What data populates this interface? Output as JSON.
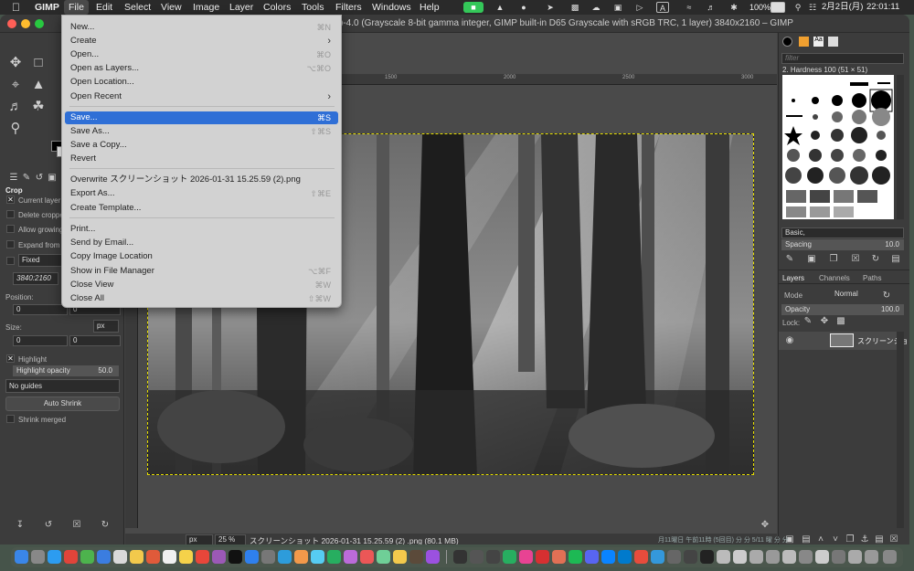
{
  "menubar": {
    "app": "GIMP",
    "items": [
      "File",
      "Edit",
      "Select",
      "View",
      "Image",
      "Layer",
      "Colors",
      "Tools",
      "Filters",
      "Windows",
      "Help"
    ],
    "date": "2月2日(月)",
    "time": "22:01:11",
    "battery": "100%",
    "input_indicator": "A"
  },
  "window": {
    "title": "[スクリーンショット 2026-01-31 15.25.59 (2)] (imported)-4.0 (Grayscale 8-bit gamma integer, GIMP built-in D65 Grayscale with sRGB TRC, 1 layer) 3840x2160 – GIMP",
    "title_visible": ")-4.0 (Grayscale 8-bit gamma integer, GIMP built-in D65 Grayscale with sRGB TRC, 1 layer) 3840x2160 – GIMP"
  },
  "file_menu": {
    "items": [
      {
        "label": "New...",
        "shortcut": "⌘N"
      },
      {
        "label": "Create",
        "submenu": "›"
      },
      {
        "label": "Open...",
        "shortcut": "⌘O"
      },
      {
        "label": "Open as Layers...",
        "shortcut": "⌥⌘O"
      },
      {
        "label": "Open Location..."
      },
      {
        "label": "Open Recent",
        "submenu": "›"
      },
      {
        "label": "Save...",
        "shortcut": "⌘S",
        "selected": true
      },
      {
        "label": "Save As...",
        "shortcut": "⇧⌘S"
      },
      {
        "label": "Save a Copy..."
      },
      {
        "label": "Revert"
      },
      {
        "label": "Overwrite スクリーンショット 2026-01-31 15.25.59 (2).png"
      },
      {
        "label": "Export As...",
        "shortcut": "⇧⌘E"
      },
      {
        "label": "Create Template..."
      },
      {
        "label": "Print..."
      },
      {
        "label": "Send by Email..."
      },
      {
        "label": "Copy Image Location"
      },
      {
        "label": "Show in File Manager",
        "shortcut": "⌥⌘F"
      },
      {
        "label": "Close View",
        "shortcut": "⌘W"
      },
      {
        "label": "Close All",
        "shortcut": "⇧⌘W"
      }
    ]
  },
  "tool_options": {
    "title": "Crop",
    "current_layer_only": "Current layer o",
    "delete_cropped": "Delete croppe",
    "allow_growing": "Allow growing",
    "expand_from": "Expand from c",
    "fixed_label": "Fixed",
    "aspect": "3840:2160",
    "position_label": "Position:",
    "position_x": "0",
    "position_y": "0",
    "size_label": "Size:",
    "size_unit": "px",
    "size_w": "0",
    "size_h": "0",
    "highlight": "Highlight",
    "highlight_opacity_label": "Highlight opacity",
    "highlight_opacity_value": "50.0",
    "guides": "No guides",
    "auto_shrink": "Auto Shrink",
    "shrink_merged": "Shrink merged"
  },
  "ruler": {
    "marks": [
      "1500",
      "2000",
      "2500",
      "3000",
      "3500"
    ]
  },
  "status": {
    "unit": "px",
    "zoom": "25 %",
    "info": "スクリーンショット 2026-01-31 15.25.59 (2) .png (80.1 MB)"
  },
  "brushes": {
    "filter_placeholder": "filter",
    "brush_name": "2. Hardness 100 (51 × 51)",
    "preset": "Basic,",
    "spacing_label": "Spacing",
    "spacing_value": "10.0"
  },
  "layers": {
    "tabs": [
      "Layers",
      "Channels",
      "Paths"
    ],
    "mode_label": "Mode",
    "mode_value": "Normal",
    "opacity_label": "Opacity",
    "opacity_value": "100.0",
    "lock_label": "Lock:",
    "layer_name": "スクリーンショ"
  },
  "bg_text": "月11曜日 午前11時 (5回目) 分 分 5/11 曜 分 分"
}
